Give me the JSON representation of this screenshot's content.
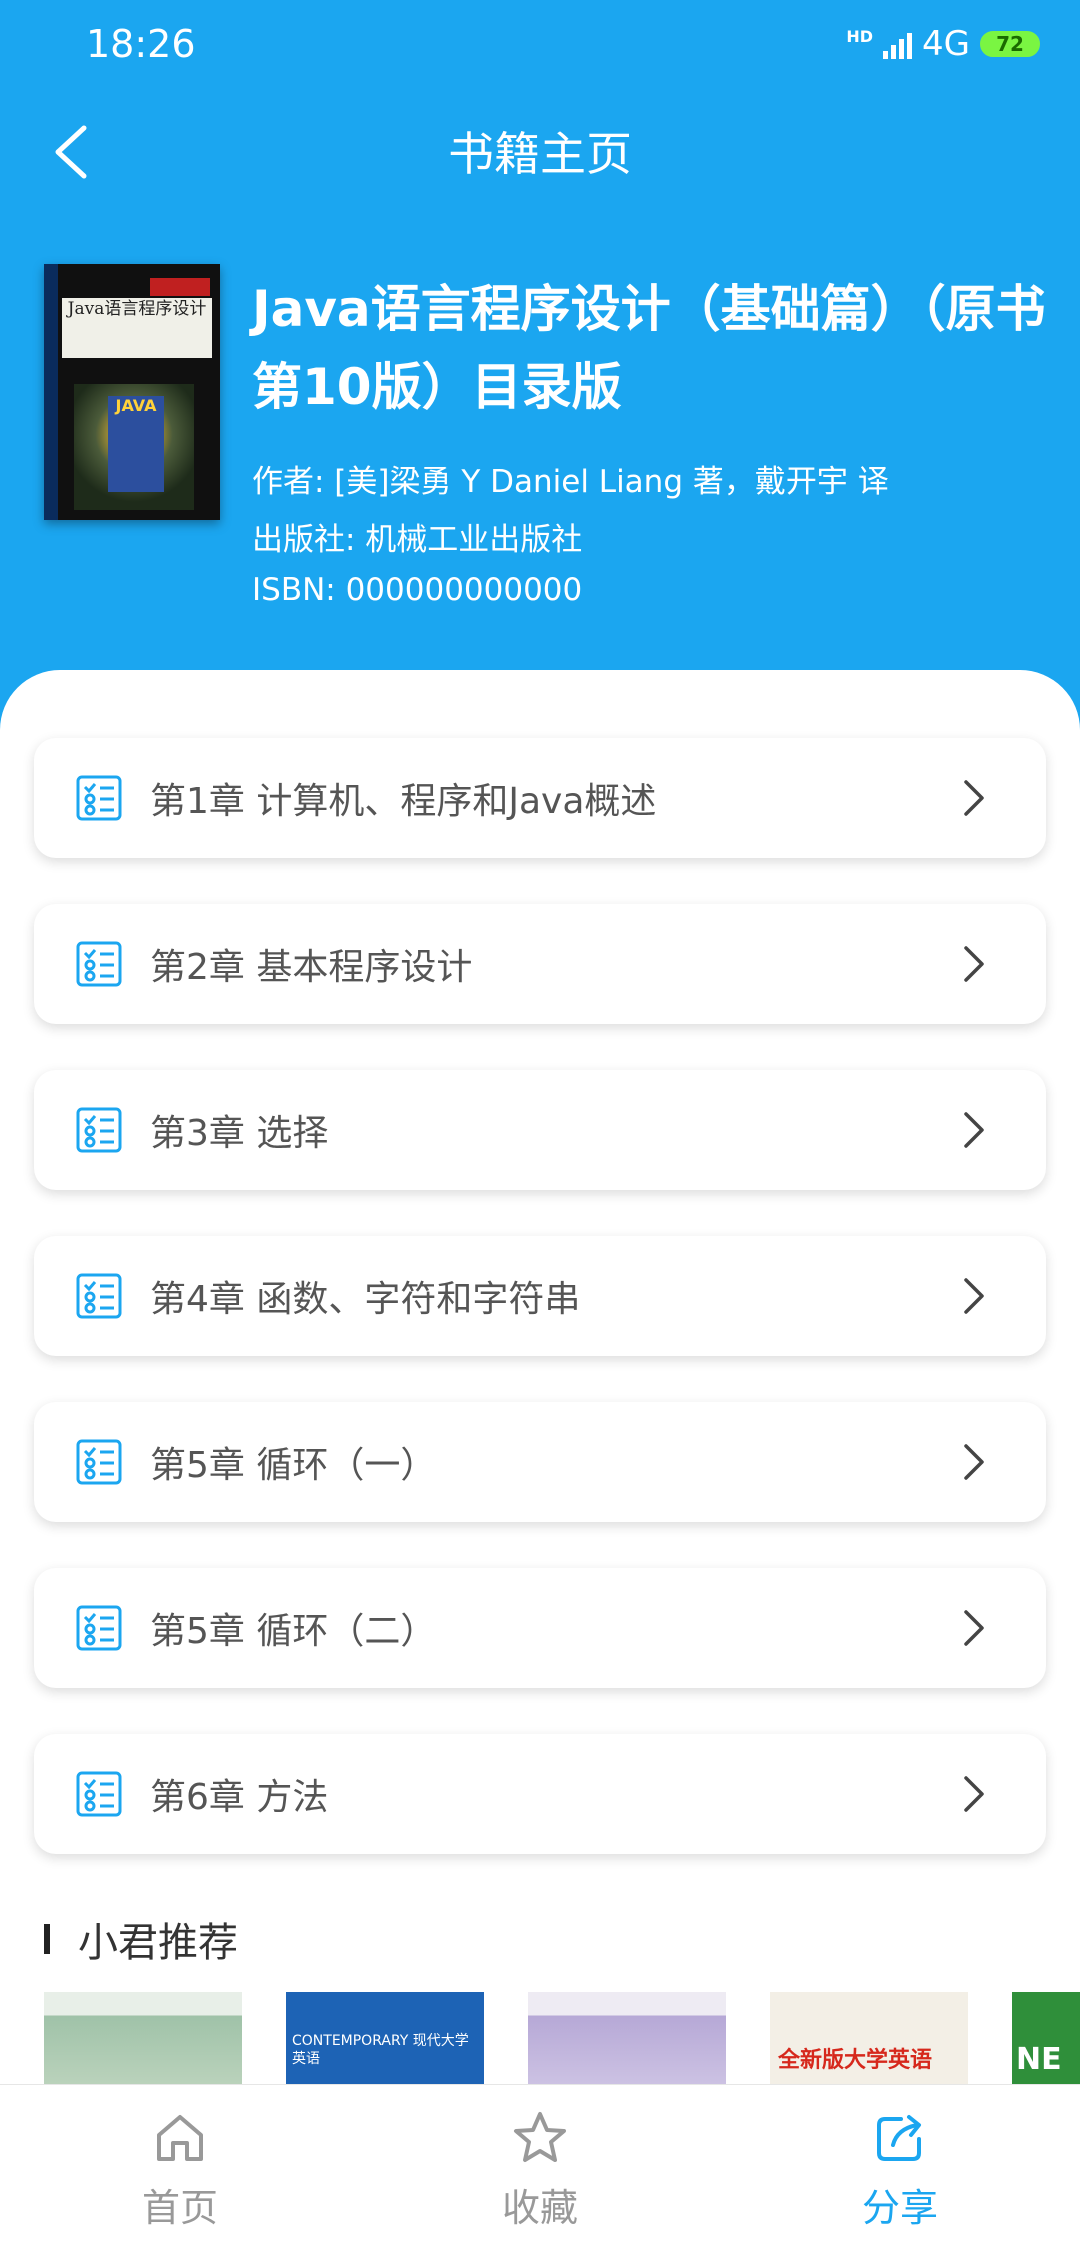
{
  "status_bar": {
    "time": "18:26",
    "hd": "HD",
    "network": "4G",
    "battery": "72"
  },
  "header": {
    "title": "书籍主页"
  },
  "book": {
    "title": "Java语言程序设计（基础篇）（原书第10版）目录版",
    "author": "作者: [美]梁勇 Y Daniel Liang 著，戴开宇 译",
    "publisher": "出版社: 机械工业出版社",
    "isbn": "ISBN: 000000000000",
    "cover_text": "Java语言程序设计"
  },
  "chapters": [
    {
      "label": "第1章 计算机、程序和Java概述"
    },
    {
      "label": "第2章 基本程序设计"
    },
    {
      "label": "第3章 选择"
    },
    {
      "label": "第4章 函数、字符和字符串"
    },
    {
      "label": "第5章 循环（一）"
    },
    {
      "label": "第5章 循环（二）"
    },
    {
      "label": "第6章 方法"
    }
  ],
  "recommend": {
    "title": "小君推荐",
    "books": [
      {
        "text": "",
        "color": "#9fc2a8"
      },
      {
        "text": "CONTEMPORARY 现代大学英语",
        "color": "#1d63b5"
      },
      {
        "text": "",
        "color": "#b6a8d6"
      },
      {
        "text": "全新版大学英语",
        "color": "#f3efe6"
      },
      {
        "text": "NE",
        "color": "#2f8f3a"
      }
    ]
  },
  "nav": {
    "home": "首页",
    "favorites": "收藏",
    "share": "分享"
  },
  "colors": {
    "primary": "#1ba6f0",
    "inactive": "#999999"
  }
}
